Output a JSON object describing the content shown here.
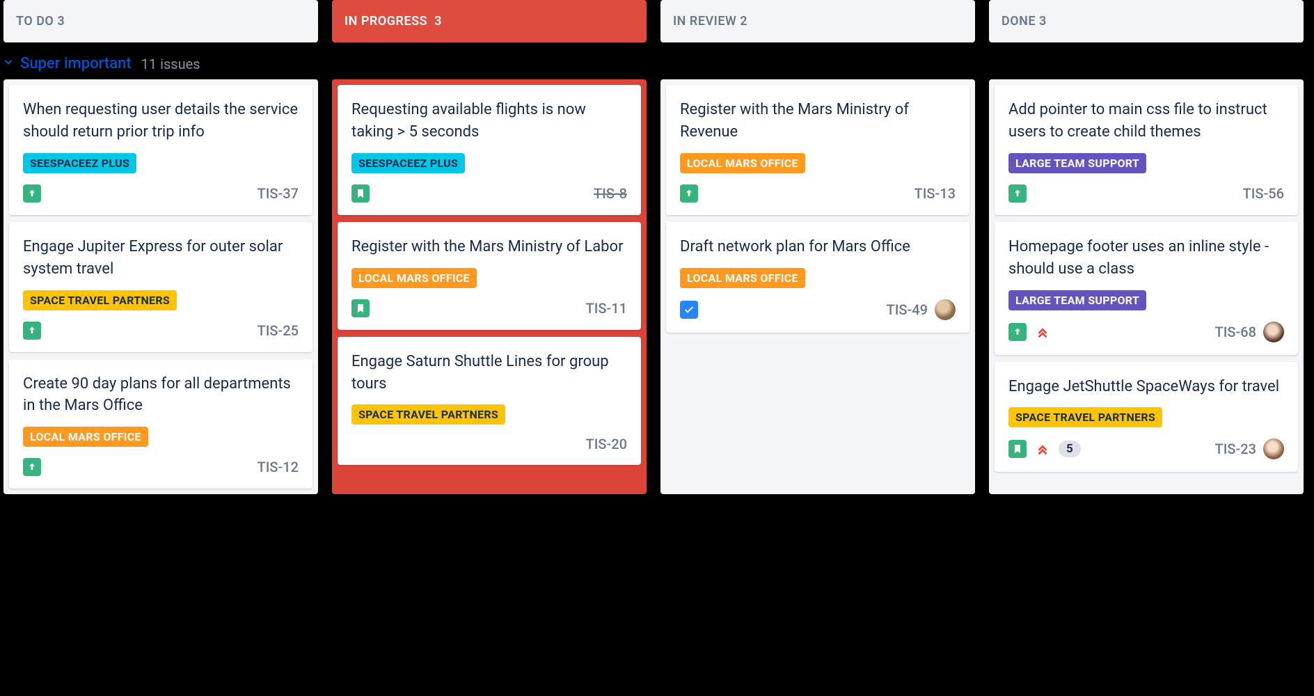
{
  "swimlane": {
    "title": "Super important",
    "count_label": "11 issues"
  },
  "columns": [
    {
      "id": "todo",
      "title": "TO DO",
      "count": 3,
      "highlighted": false
    },
    {
      "id": "inprogress",
      "title": "IN PROGRESS",
      "count": 3,
      "highlighted": true
    },
    {
      "id": "inreview",
      "title": "IN REVIEW",
      "count": 2,
      "highlighted": false
    },
    {
      "id": "done",
      "title": "DONE",
      "count": 3,
      "highlighted": false
    }
  ],
  "epics": {
    "seespaceez": "SEESPACEEZ PLUS",
    "spacetravel": "SPACE TRAVEL PARTNERS",
    "localmars": "LOCAL MARS OFFICE",
    "largeteam": "LARGE TEAM SUPPORT"
  },
  "cards": {
    "todo": [
      {
        "title": "When requesting user details the service should return prior trip info",
        "epic": "seespaceez",
        "type": "story",
        "prio": "up",
        "key": "TIS-37"
      },
      {
        "title": "Engage Jupiter Express for outer solar system travel",
        "epic": "spacetravel",
        "type": "story",
        "prio": "up",
        "key": "TIS-25"
      },
      {
        "title": "Create 90 day plans for all departments in the Mars Office",
        "epic": "localmars",
        "type": "story",
        "prio": "up",
        "key": "TIS-12"
      }
    ],
    "inprogress": [
      {
        "title": "Requesting available flights is now taking > 5 seconds",
        "epic": "seespaceez",
        "type": "story",
        "key": "TIS-8",
        "strike": true
      },
      {
        "title": "Register with the Mars Ministry of Labor",
        "epic": "localmars",
        "type": "story",
        "key": "TIS-11"
      },
      {
        "title": "Engage Saturn Shuttle Lines for group tours",
        "epic": "spacetravel",
        "key": "TIS-20"
      }
    ],
    "inreview": [
      {
        "title": "Register with the Mars Ministry of Revenue",
        "epic": "localmars",
        "type": "story",
        "prio": "up",
        "key": "TIS-13"
      },
      {
        "title": "Draft network plan for Mars Office",
        "epic": "localmars",
        "type": "task",
        "key": "TIS-49",
        "avatar": "a1"
      }
    ],
    "done": [
      {
        "title": "Add pointer to main css file to instruct users to create child themes",
        "epic": "largeteam",
        "type": "story",
        "prio": "up",
        "key": "TIS-56"
      },
      {
        "title": "Homepage footer uses an inline style - should use a class",
        "epic": "largeteam",
        "type": "story",
        "prio": "up",
        "prio2": "highest",
        "key": "TIS-68",
        "avatar": "a2"
      },
      {
        "title": "Engage JetShuttle SpaceWays for travel",
        "epic": "spacetravel",
        "type": "story",
        "prio2": "highest",
        "sp": "5",
        "key": "TIS-23",
        "avatar": "a3"
      }
    ]
  }
}
